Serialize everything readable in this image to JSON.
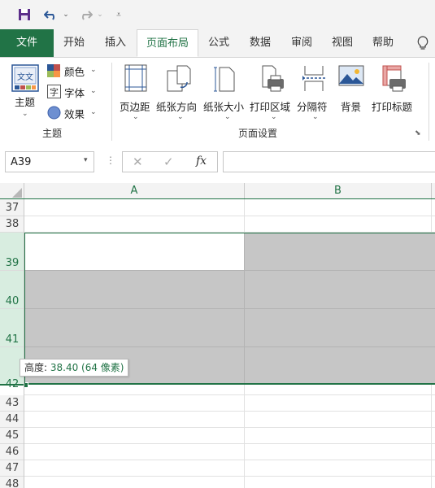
{
  "tabs": [
    {
      "label": "文件",
      "key": "file"
    },
    {
      "label": "开始",
      "key": "home"
    },
    {
      "label": "插入",
      "key": "insert"
    },
    {
      "label": "页面布局",
      "key": "page-layout",
      "active": true
    },
    {
      "label": "公式",
      "key": "formulas"
    },
    {
      "label": "数据",
      "key": "data"
    },
    {
      "label": "审阅",
      "key": "review"
    },
    {
      "label": "视图",
      "key": "view"
    },
    {
      "label": "帮助",
      "key": "help"
    }
  ],
  "ribbon": {
    "themes": {
      "theme": "主题",
      "colors": "颜色",
      "fonts": "字体",
      "effects": "效果",
      "group": "主题"
    },
    "page_setup": {
      "margins": "页边距",
      "orientation": "纸张方向",
      "size": "纸张大小",
      "print_area": "打印区域",
      "breaks": "分隔符",
      "background": "背景",
      "print_titles": "打印标题",
      "group": "页面设置"
    },
    "theme_icon_text": "文文"
  },
  "formula_bar": {
    "name_box": "A39",
    "fx": "fx",
    "cancel": "✕",
    "enter": "✓",
    "formula": ""
  },
  "columns": [
    "A",
    "B"
  ],
  "rows": [
    "37",
    "38",
    "39",
    "40",
    "41",
    "42",
    "43",
    "44",
    "45",
    "46",
    "47",
    "48"
  ],
  "tooltip": {
    "label": "高度: ",
    "value": "38.40 (64 像素)"
  },
  "colors": {
    "accent": "#217346",
    "selection_fill": "#c6c6c6",
    "row_header_selected": "#d8ede0"
  }
}
